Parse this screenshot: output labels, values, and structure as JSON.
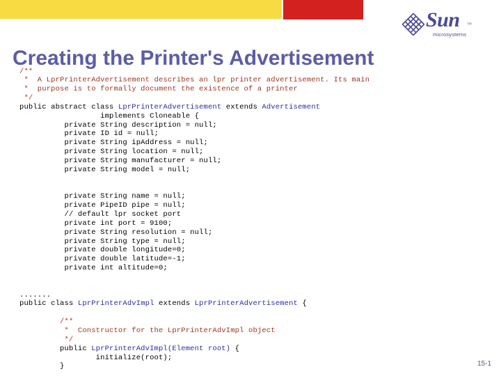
{
  "slide": {
    "title": "Creating the Printer's Advertisement",
    "page_number": "15-1",
    "title_color": "#5C5CA6"
  },
  "decor": {
    "yellow_bar_color": "#F8DB43",
    "red_bar_color": "#D32120"
  },
  "logo": {
    "wordmark": "Sun",
    "trademark": "™",
    "subtext": "microsystems",
    "color": "#4A4A96"
  },
  "code": {
    "comment_color": "#9B3524",
    "class_color": "#262C9E",
    "text_color": "#000000",
    "lines": [
      {
        "id": "l01",
        "segments": [
          {
            "t": "/**",
            "k": "cmt"
          }
        ]
      },
      {
        "id": "l02",
        "segments": [
          {
            "t": " *  A LprPrinterAdvertisement describes an lpr printer advertisement. Its main",
            "k": "cmt"
          }
        ]
      },
      {
        "id": "l03",
        "segments": [
          {
            "t": " *  purpose is to formally document the existence of a printer",
            "k": "cmt"
          }
        ]
      },
      {
        "id": "l04",
        "segments": [
          {
            "t": " */",
            "k": "cmt"
          }
        ]
      },
      {
        "id": "l05",
        "segments": [
          {
            "t": "public abstract class ",
            "k": "txt"
          },
          {
            "t": "LprPrinterAdvertisement",
            "k": "cls"
          },
          {
            "t": " extends ",
            "k": "txt"
          },
          {
            "t": "Advertisement",
            "k": "cls"
          }
        ]
      },
      {
        "id": "l06",
        "segments": [
          {
            "t": "                  implements Cloneable {",
            "k": "txt"
          }
        ]
      },
      {
        "id": "l07",
        "segments": [
          {
            "t": "          private String description = null;",
            "k": "txt"
          }
        ]
      },
      {
        "id": "l08",
        "segments": [
          {
            "t": "          private ID id = null;",
            "k": "txt"
          }
        ]
      },
      {
        "id": "l09",
        "segments": [
          {
            "t": "          private String ipAddress = null;",
            "k": "txt"
          }
        ]
      },
      {
        "id": "l10",
        "segments": [
          {
            "t": "          private String location = null;",
            "k": "txt"
          }
        ]
      },
      {
        "id": "l11",
        "segments": [
          {
            "t": "          private String manufacturer = null;",
            "k": "txt"
          }
        ]
      },
      {
        "id": "l12",
        "segments": [
          {
            "t": "          private String model = null;",
            "k": "txt"
          }
        ]
      },
      {
        "id": "l13",
        "segments": []
      },
      {
        "id": "l14",
        "segments": []
      },
      {
        "id": "l15",
        "segments": [
          {
            "t": "          private String name = null;",
            "k": "txt"
          }
        ]
      },
      {
        "id": "l16",
        "segments": [
          {
            "t": "          private PipeID pipe = null;",
            "k": "txt"
          }
        ]
      },
      {
        "id": "l17",
        "segments": [
          {
            "t": "          // default lpr socket port",
            "k": "txt"
          }
        ]
      },
      {
        "id": "l18",
        "segments": [
          {
            "t": "          private int port = 9100;",
            "k": "txt"
          }
        ]
      },
      {
        "id": "l19",
        "segments": [
          {
            "t": "          private String resolution = null;",
            "k": "txt"
          }
        ]
      },
      {
        "id": "l20",
        "segments": [
          {
            "t": "          private String type = null;",
            "k": "txt"
          }
        ]
      },
      {
        "id": "l21",
        "segments": [
          {
            "t": "          private double longitude=0;",
            "k": "txt"
          }
        ]
      },
      {
        "id": "l22",
        "segments": [
          {
            "t": "          private double latitude=-1;",
            "k": "txt"
          }
        ]
      },
      {
        "id": "l23",
        "segments": [
          {
            "t": "          private int altitude=0;",
            "k": "txt"
          }
        ]
      },
      {
        "id": "l24",
        "segments": []
      },
      {
        "id": "l25",
        "segments": []
      },
      {
        "id": "l26",
        "segments": [
          {
            "t": ".......",
            "k": "txt"
          }
        ]
      },
      {
        "id": "l27",
        "segments": [
          {
            "t": "public class ",
            "k": "txt"
          },
          {
            "t": "LprPrinterAdvImpl",
            "k": "cls"
          },
          {
            "t": " extends ",
            "k": "txt"
          },
          {
            "t": "LprPrinterAdvertisement",
            "k": "cls"
          },
          {
            "t": " {",
            "k": "txt"
          }
        ]
      },
      {
        "id": "l28",
        "segments": []
      },
      {
        "id": "l29",
        "segments": [
          {
            "t": "         /**",
            "k": "cmt"
          }
        ]
      },
      {
        "id": "l30",
        "segments": [
          {
            "t": "          *  Constructor for the LprPrinterAdvImpl object",
            "k": "cmt"
          }
        ]
      },
      {
        "id": "l31",
        "segments": [
          {
            "t": "          */",
            "k": "cmt"
          }
        ]
      },
      {
        "id": "l32",
        "segments": [
          {
            "t": "         public ",
            "k": "txt"
          },
          {
            "t": "LprPrinterAdvImpl(Element root)",
            "k": "cls"
          },
          {
            "t": " {",
            "k": "txt"
          }
        ]
      },
      {
        "id": "l33",
        "segments": [
          {
            "t": "                 initialize(root);",
            "k": "txt"
          }
        ]
      },
      {
        "id": "l34",
        "segments": [
          {
            "t": "         }",
            "k": "txt"
          }
        ]
      }
    ]
  }
}
